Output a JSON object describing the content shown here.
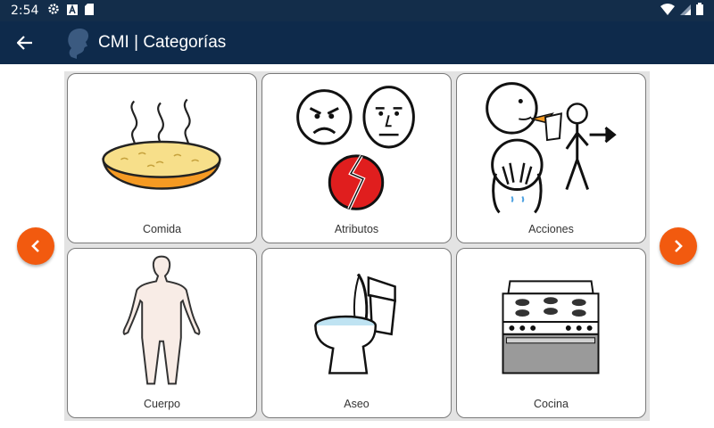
{
  "status_bar": {
    "time": "2:54"
  },
  "app_bar": {
    "title": "CMI | Categorías"
  },
  "categories": [
    {
      "label": "Comida"
    },
    {
      "label": "Atributos"
    },
    {
      "label": "Acciones"
    },
    {
      "label": "Cuerpo"
    },
    {
      "label": "Aseo"
    },
    {
      "label": "Cocina"
    }
  ],
  "colors": {
    "status_bar": "#132d4a",
    "app_bar": "#0e2a4b",
    "accent": "#f25a0f",
    "grid_bg": "#e3e3e3"
  }
}
